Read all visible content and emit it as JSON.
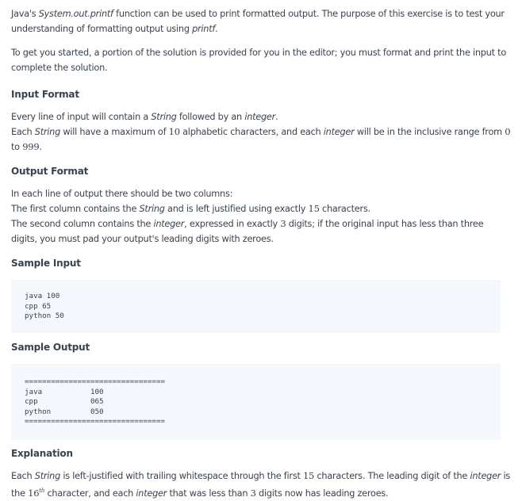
{
  "intro": {
    "p1": [
      "Java's ",
      "System.out.printf",
      " function can be used to print formatted output. The purpose of this exercise is to test your understanding of formatting output using ",
      "printf",
      "."
    ],
    "p2": "To get you started, a portion of the solution is provided for you in the editor; you must format and print the input to complete the solution."
  },
  "input_format": {
    "heading": "Input Format",
    "line1": [
      "Every line of input will contain a ",
      "String",
      " followed by an ",
      "integer",
      "."
    ],
    "line2": [
      "Each ",
      "String",
      " will have a maximum of ",
      "10",
      " alphabetic characters, and each ",
      "integer",
      " will be in the inclusive range from ",
      "0",
      " to ",
      "999",
      "."
    ]
  },
  "output_format": {
    "heading": "Output Format",
    "line1": "In each line of output there should be two columns:",
    "line2": [
      "The first column contains the ",
      "String",
      " and is left justified using exactly ",
      "15",
      " characters."
    ],
    "line3": [
      "The second column contains the ",
      "integer",
      ", expressed in exactly ",
      "3",
      " digits; if the original input has less than three digits, you must pad your output's leading digits with zeroes."
    ]
  },
  "sample_input": {
    "heading": "Sample Input",
    "code": "java 100\ncpp 65\npython 50"
  },
  "sample_output": {
    "heading": "Sample Output",
    "code": "================================\njava           100\ncpp            065\npython         050\n================================"
  },
  "explanation": {
    "heading": "Explanation",
    "text": [
      "Each ",
      "String",
      " is left-justified with trailing whitespace through the first ",
      "15",
      " characters. The leading digit of the ",
      "integer",
      " is the ",
      "16",
      "th",
      " character, and each ",
      "integer",
      " that was less than ",
      "3",
      " digits now has leading zeroes."
    ]
  }
}
